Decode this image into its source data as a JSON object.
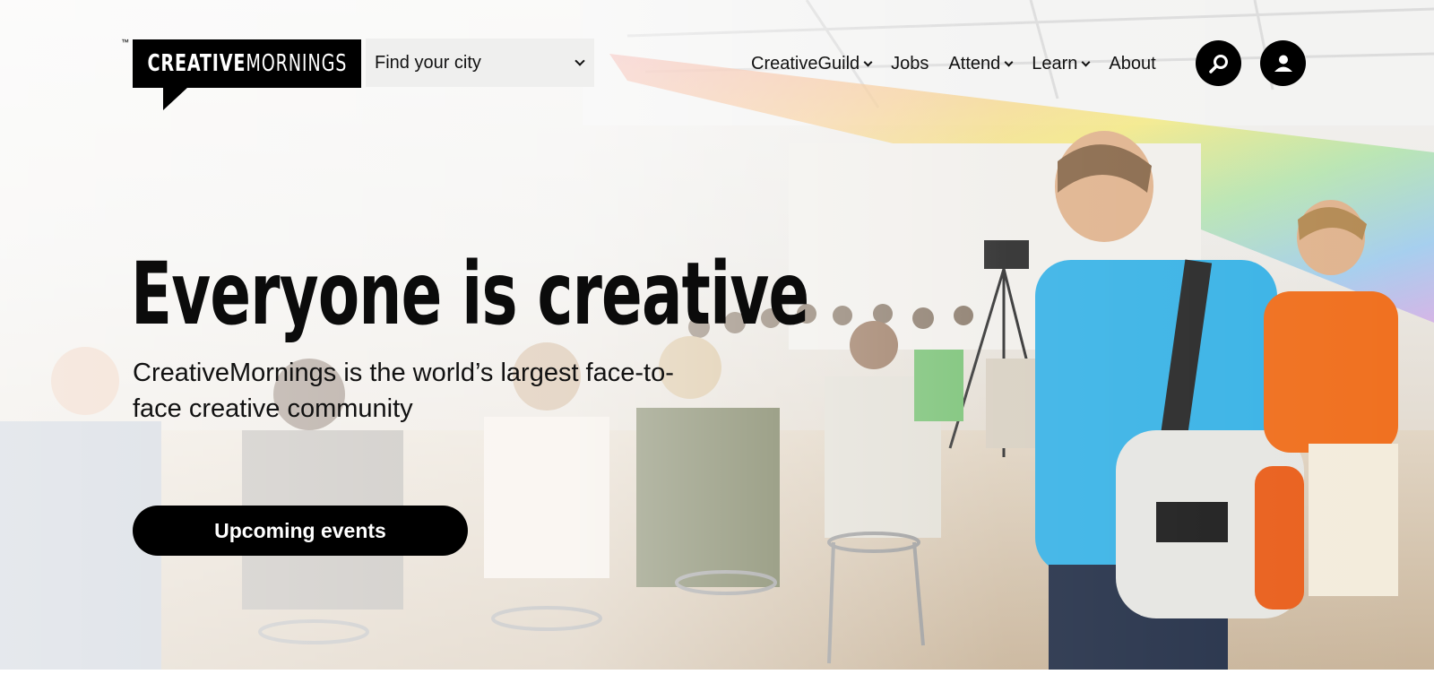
{
  "header": {
    "logo_tm": "™",
    "logo_bold": "CREATIVE",
    "logo_light": "MORNINGS",
    "city_select": {
      "selected": "Find your city"
    }
  },
  "nav": {
    "items": [
      {
        "label": "CreativeGuild",
        "dropdown": true
      },
      {
        "label": "Jobs",
        "dropdown": false
      },
      {
        "label": "Attend",
        "dropdown": true
      },
      {
        "label": "Learn",
        "dropdown": true
      },
      {
        "label": "About",
        "dropdown": false
      }
    ],
    "search_icon": "search-icon",
    "user_icon": "user-icon"
  },
  "hero": {
    "headline": "Everyone is creative",
    "subhead": "CreativeMornings is the world’s largest face-to-face creative community",
    "cta_label": "Upcoming events"
  },
  "colors": {
    "brand_black": "#000000",
    "select_bg": "#efefee",
    "person_blue_shirt": "#3ab3e6",
    "person_orange_shirt": "#f0701f"
  }
}
